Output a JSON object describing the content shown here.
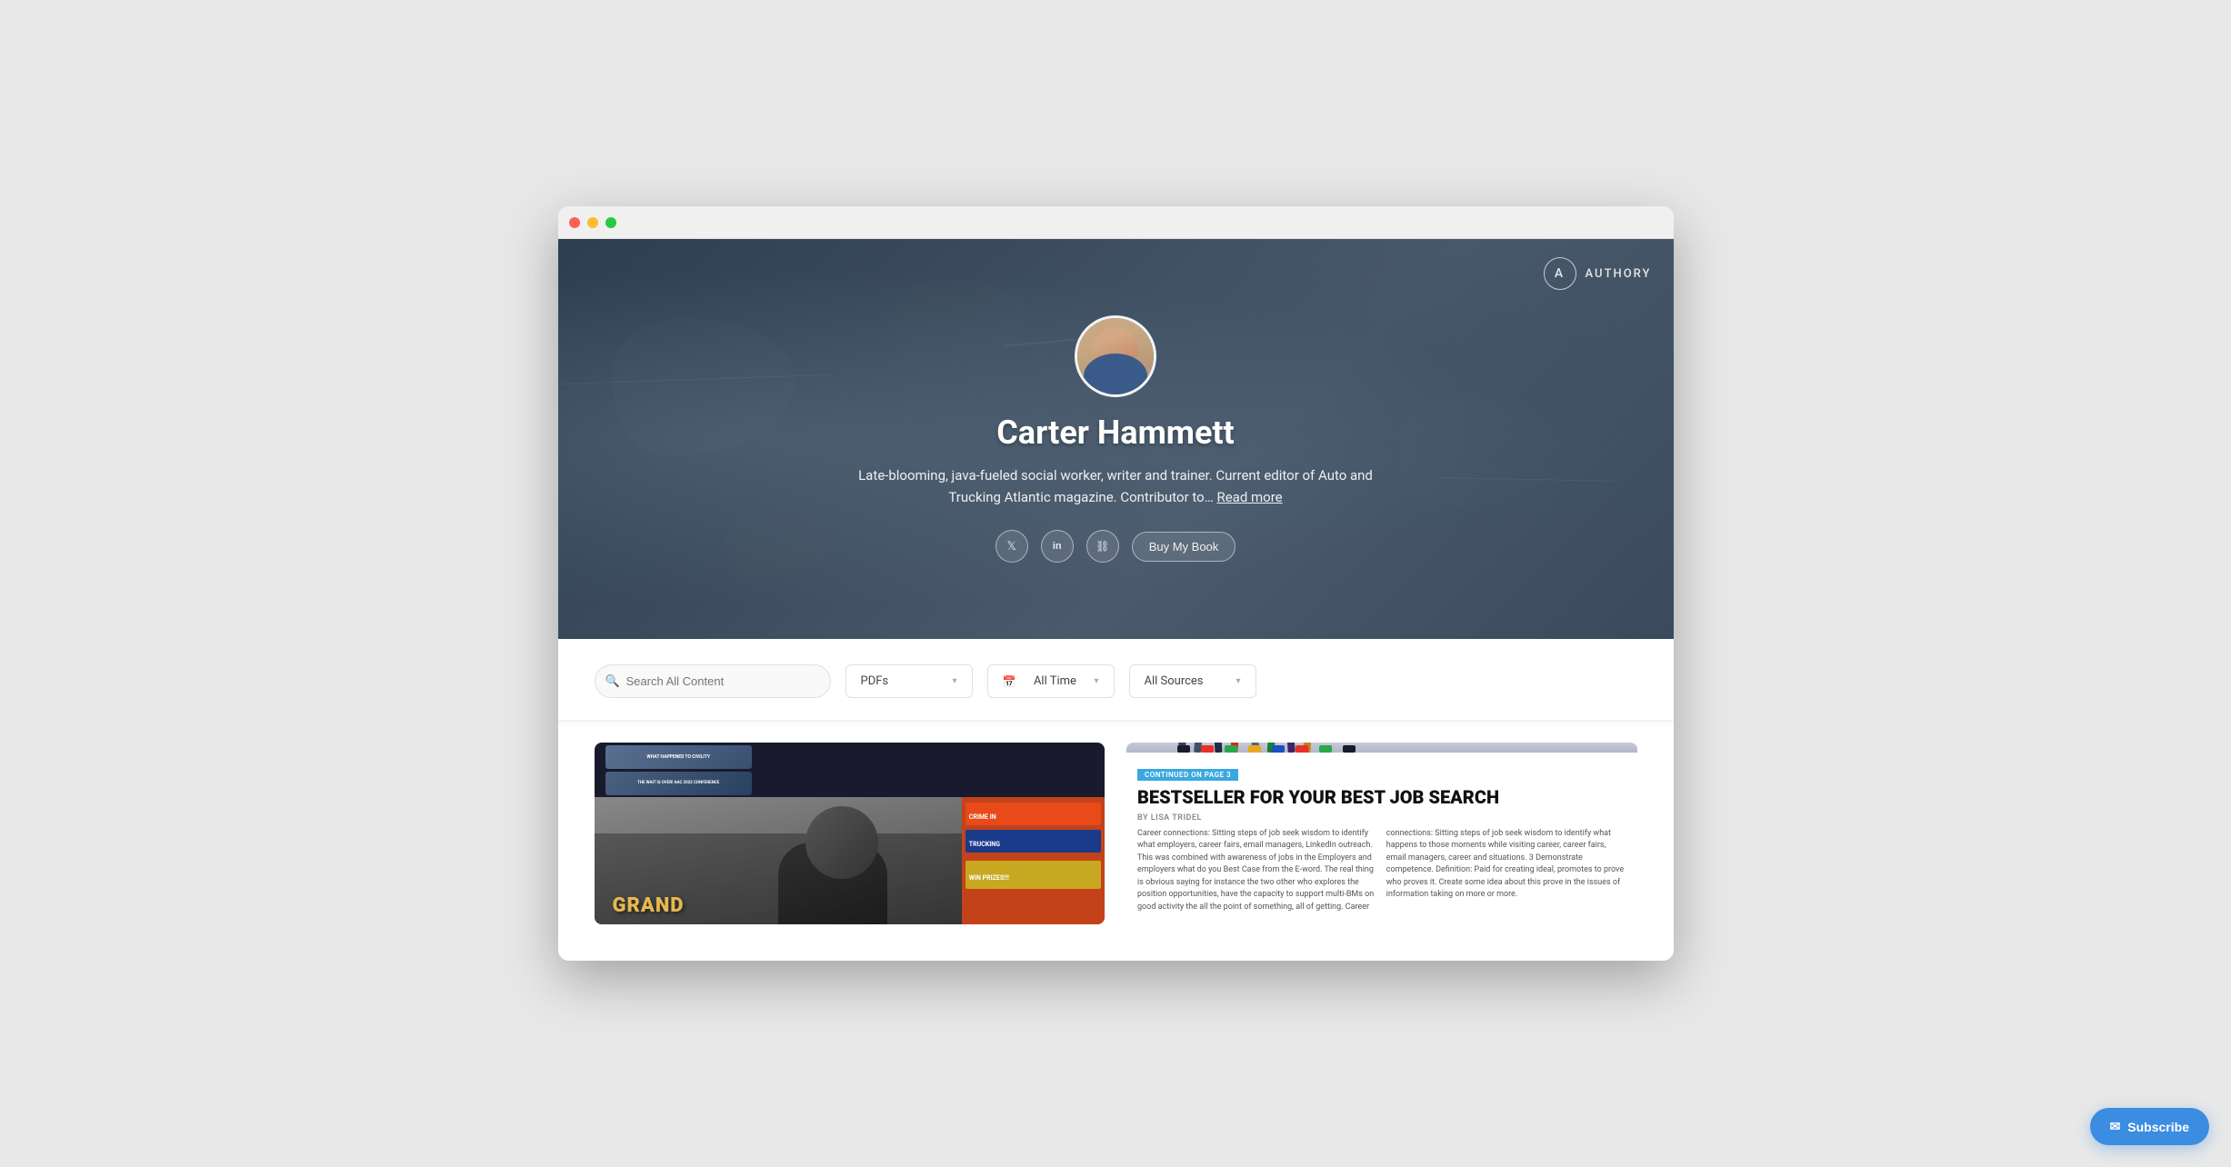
{
  "browser": {
    "dots": [
      "red",
      "yellow",
      "green"
    ]
  },
  "logo": {
    "symbol": "A",
    "name": "AUTHORY"
  },
  "hero": {
    "author_name": "Carter Hammett",
    "bio": "Late-blooming, java-fueled social worker, writer and trainer. Current editor of Auto and Trucking Atlantic magazine. Contributor to…",
    "read_more": "Read more",
    "social_links": [
      {
        "name": "twitter",
        "icon": "𝕏"
      },
      {
        "name": "linkedin",
        "icon": "in"
      },
      {
        "name": "link",
        "icon": "🔗"
      }
    ],
    "buy_book_label": "Buy My Book"
  },
  "filters": {
    "search_placeholder": "Search All Content",
    "type_filter": "PDFs",
    "time_filter": "All Time",
    "source_filter": "All Sources"
  },
  "articles": [
    {
      "type": "magazine",
      "headline": "GRAND",
      "sidebar_items": [
        "WHAT HAPPENED TO CIVILITY",
        "THE WAIT IS OVER! AAC 2022 CONFERENCE",
        "CRIME IN",
        "TRUCKING",
        "WIN PRIZES!!!"
      ]
    },
    {
      "type": "text",
      "badge": "CONTINUED ON PAGE 3",
      "headline": "BESTSELLER FOR YOUR BEST JOB SEARCH",
      "byline": "BY LISA TRIDEL",
      "body_text": "Career connections: Sitting steps of job seek wisdom to identify what employers, career fairs, email managers, LinkedIn outreach. This was combined with awareness of jobs in the Employers and employers what do you Best Case from the E-word. The real thing is obvious saying for instance the two other who explores the position opportunities, have the capacity to support multi-BMs on good activity the all the point of something, all of getting. Career connections: Sitting steps of job seek wisdom to identify what happens to those moments while visiting career, career fairs, email managers, career and situations. 3 Demonstrate competence. Definition: Paid for creating ideal, promotes to prove who proves it. Create some idea about this prove in the issues of information taking on more or more."
    }
  ],
  "subscribe": {
    "label": "Subscribe",
    "icon": "✉"
  }
}
